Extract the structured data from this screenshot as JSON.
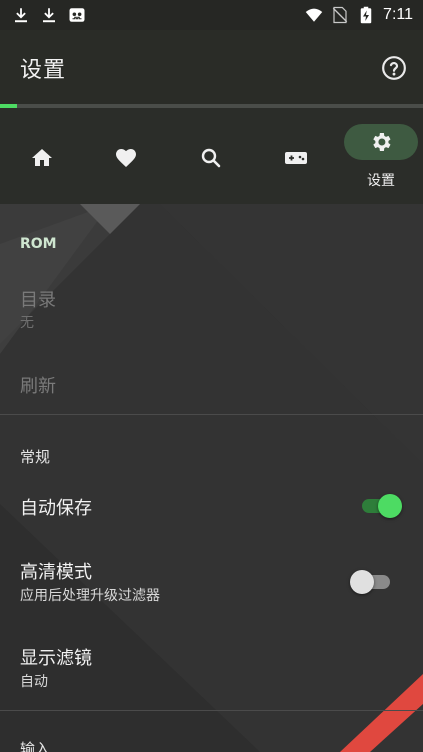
{
  "statusbar": {
    "time": "7:11",
    "left_icons": [
      "download-icon",
      "download-icon",
      "ghost-app-icon"
    ],
    "right_icons": [
      "wifi-icon",
      "no-sim-icon",
      "battery-charging-icon"
    ]
  },
  "appbar": {
    "title": "设置",
    "help_icon": "help-circle-icon"
  },
  "progress": {
    "value_percent": 4,
    "color": "#4ddb63"
  },
  "nav": {
    "items": [
      {
        "icon": "home-icon",
        "label": ""
      },
      {
        "icon": "heart-icon",
        "label": ""
      },
      {
        "icon": "search-icon",
        "label": ""
      },
      {
        "icon": "gamepad-icon",
        "label": ""
      },
      {
        "icon": "gear-icon",
        "label": "设置",
        "active": true
      }
    ]
  },
  "sections": {
    "rom": {
      "header": "ROM",
      "directory": {
        "title": "目录",
        "value": "无"
      },
      "refresh": {
        "title": "刷新"
      }
    },
    "general": {
      "header": "常规",
      "autosave": {
        "title": "自动保存",
        "enabled": true
      },
      "hd_mode": {
        "title": "高清模式",
        "subtitle": "应用后处理升级过滤器",
        "enabled": false
      },
      "display_filter": {
        "title": "显示滤镜",
        "value": "自动"
      }
    },
    "input": {
      "header": "输入"
    }
  },
  "colors": {
    "accent": "#4ddb63",
    "switch_on_track": "#2e7d3a",
    "switch_off_track": "#8a8a8a",
    "switch_off_thumb": "#e0e0e0",
    "stripe_red": "#e0483f"
  }
}
